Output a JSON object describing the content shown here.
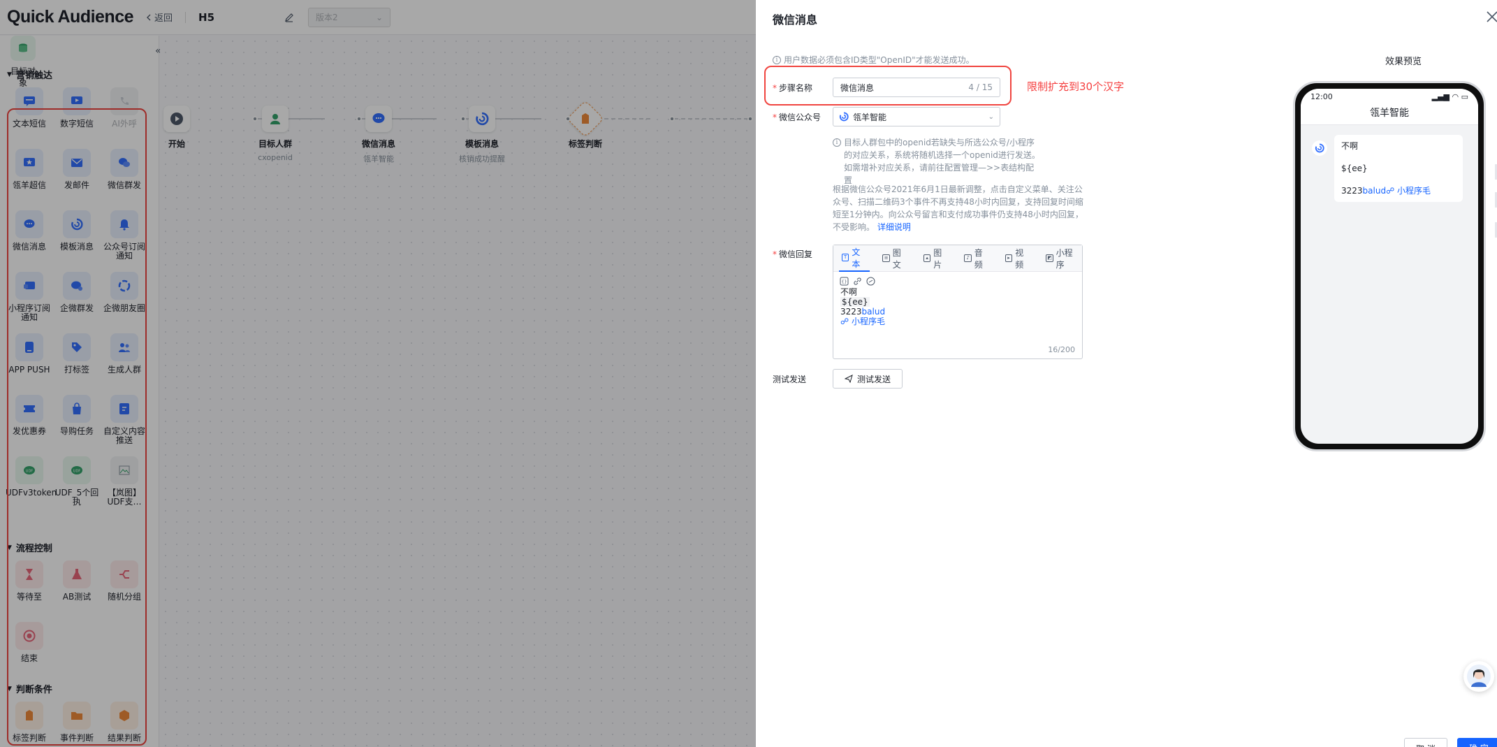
{
  "app": {
    "brand": "Quick Audience",
    "back_label": "返回",
    "channel": "H5",
    "version_placeholder": "版本2"
  },
  "sidebar": {
    "target_object_label": "目标对象",
    "sections": [
      {
        "title": "营销触达",
        "items": [
          {
            "label": "文本短信",
            "icon": "sms-icon",
            "disabled": false
          },
          {
            "label": "数字短信",
            "icon": "video-sms-icon",
            "disabled": false
          },
          {
            "label": "AI外呼",
            "icon": "phone-icon",
            "disabled": true
          },
          {
            "label": "瓴羊超信",
            "icon": "star-message-icon",
            "disabled": false
          },
          {
            "label": "发邮件",
            "icon": "mail-icon",
            "disabled": false
          },
          {
            "label": "微信群发",
            "icon": "wechat-icon",
            "disabled": false
          },
          {
            "label": "微信消息",
            "icon": "wechat-message-icon",
            "disabled": false
          },
          {
            "label": "模板消息",
            "icon": "template-message-icon",
            "disabled": false
          },
          {
            "label": "公众号订阅通知",
            "icon": "bell-icon",
            "disabled": false
          },
          {
            "label": "小程序订阅通知",
            "icon": "mini-program-icon",
            "disabled": false
          },
          {
            "label": "企微群发",
            "icon": "wecom-broadcast-icon",
            "disabled": false
          },
          {
            "label": "企微朋友圈",
            "icon": "wecom-moments-icon",
            "disabled": false
          },
          {
            "label": "APP PUSH",
            "icon": "app-push-icon",
            "disabled": false
          },
          {
            "label": "打标签",
            "icon": "tag-icon",
            "disabled": false
          },
          {
            "label": "生成人群",
            "icon": "group-icon",
            "disabled": false
          },
          {
            "label": "发优惠券",
            "icon": "coupon-icon",
            "disabled": false
          },
          {
            "label": "导购任务",
            "icon": "shopping-task-icon",
            "disabled": false
          },
          {
            "label": "自定义内容推送",
            "icon": "custom-push-icon",
            "disabled": false
          },
          {
            "label": "UDFv3token",
            "icon": "udf-icon",
            "disabled": false
          },
          {
            "label": "UDF_5个回执",
            "icon": "udf-icon",
            "disabled": false
          },
          {
            "label": "【岚图】UDF支…",
            "icon": "broken-image-icon",
            "disabled": false
          }
        ]
      },
      {
        "title": "流程控制",
        "items": [
          {
            "label": "等待至",
            "icon": "hourglass-icon",
            "disabled": false
          },
          {
            "label": "AB测试",
            "icon": "flask-icon",
            "disabled": false
          },
          {
            "label": "随机分组",
            "icon": "split-icon",
            "disabled": false
          },
          {
            "label": "结束",
            "icon": "end-icon",
            "disabled": false
          }
        ]
      },
      {
        "title": "判断条件",
        "items": [
          {
            "label": "标签判断",
            "icon": "tag-judge-icon",
            "disabled": false
          },
          {
            "label": "事件判断",
            "icon": "event-judge-icon",
            "disabled": false
          },
          {
            "label": "结果判断",
            "icon": "result-judge-icon",
            "disabled": false
          }
        ]
      }
    ]
  },
  "canvas": {
    "nodes": [
      {
        "title": "开始",
        "sub": "",
        "icon": "play-icon"
      },
      {
        "title": "目标人群",
        "sub": "cxopenid",
        "icon": "person-icon"
      },
      {
        "title": "微信消息",
        "sub": "瓴羊智能",
        "icon": "wechat-message-icon"
      },
      {
        "title": "模板消息",
        "sub": "核销成功提醒",
        "icon": "template-message-icon"
      },
      {
        "title": "标签判断",
        "sub": "",
        "icon": "tag-judge-icon"
      }
    ]
  },
  "drawer": {
    "title": "微信消息",
    "notice": "用户数据必须包含ID类型\"OpenID\"才能发送成功。",
    "step_name": {
      "label": "步骤名称",
      "value": "微信消息",
      "count": "4 / 15",
      "annotation": "限制扩充到30个汉字"
    },
    "official_account": {
      "label": "微信公众号",
      "value": "瓴羊智能"
    },
    "hint_openid": "目标人群包中的openid若缺失与所选公众号/小程序的对应关系，系统将随机选择一个openid进行发送。如需增补对应关系，请前往配置管理—>>表结构配置",
    "hint_policy": "根据微信公众号2021年6月1日最新调整，点击自定义菜单、关注公众号、扫描二维码3个事件不再支持48小时内回复，支持回复时间缩短至1分钟内。向公众号留言和支付成功事件仍支持48小时内回复，不受影响。",
    "hint_link": "详细说明",
    "reply": {
      "label": "微信回复",
      "tabs": [
        "文本",
        "图文",
        "图片",
        "音频",
        "视频",
        "小程序"
      ],
      "active_tab": "文本",
      "lines": {
        "line1": "不啊",
        "line2": "${ee}",
        "line3_prefix": "3223",
        "line3_link": "balud",
        "line4_link": "小程序毛"
      },
      "count": "16/200"
    },
    "test": {
      "label": "测试发送",
      "button": "测试发送"
    },
    "preview": {
      "title": "效果预览",
      "time": "12:00",
      "account": "瓴羊智能",
      "msg_line1": "不啊",
      "msg_line2": "${ee}",
      "msg_line3_prefix": "3223",
      "msg_line3_link": "balud",
      "msg_line3_mini": "小程序毛"
    },
    "footer": {
      "cancel": "取 消",
      "ok": "确 定"
    }
  },
  "colors": {
    "primary": "#1664ff",
    "annotation_red": "#f0443f",
    "wechat_green": "#07c160"
  }
}
